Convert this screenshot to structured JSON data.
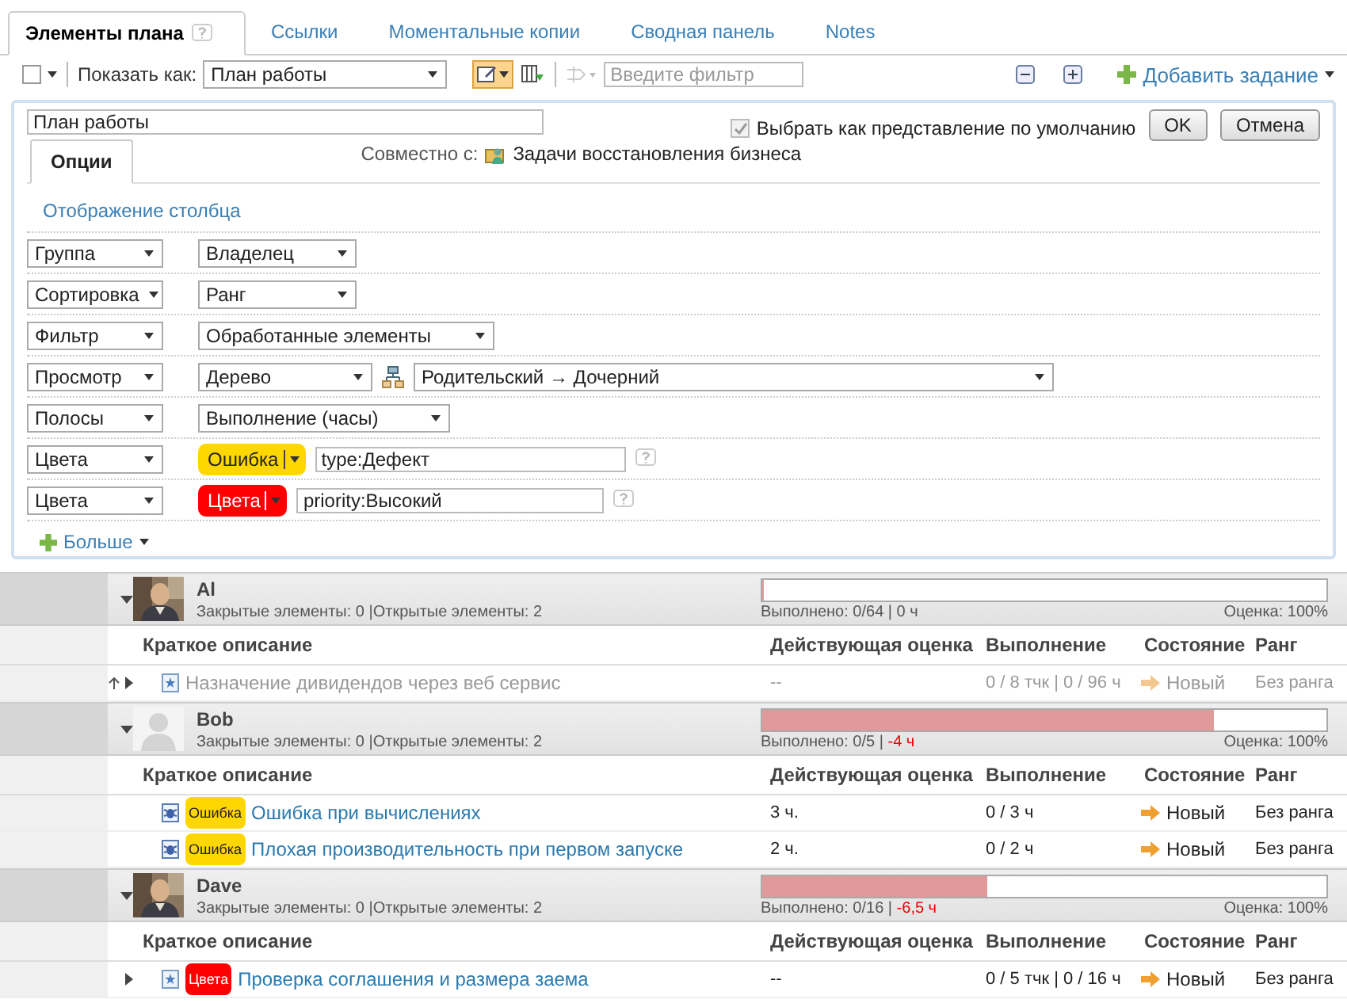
{
  "tabs": [
    {
      "label": "Элементы плана",
      "selected": true,
      "help": true
    },
    {
      "label": "Ссылки",
      "selected": false,
      "help": false
    },
    {
      "label": "Моментальные копии",
      "selected": false,
      "help": false
    },
    {
      "label": "Сводная панель",
      "selected": false,
      "help": false
    },
    {
      "label": "Notes",
      "selected": false,
      "help": false
    }
  ],
  "toolbar": {
    "select_all_checked": false,
    "show_as_label": "Показать как:",
    "view": "План работы",
    "view_editor_pressed": true,
    "filter_placeholder": "Введите фильтр",
    "add_task": "Добавить задание"
  },
  "editor": {
    "name": "План работы",
    "default_checkbox": {
      "label": "Выбрать как представление по умолчанию",
      "checked": true
    },
    "ok": "OK",
    "cancel": "Отмена",
    "options_tab": "Опции",
    "shared_label": "Совместно с:",
    "shared_value": "Задачи восстановления бизнеса",
    "column_link": "Отображение столбца",
    "rules": [
      {
        "kind": "select",
        "type": "Группа",
        "value": "Владелец"
      },
      {
        "kind": "select",
        "type": "Сортировка",
        "value": "Ранг"
      },
      {
        "kind": "select",
        "type": "Фильтр",
        "value": "Обработанные элементы"
      },
      {
        "kind": "hierarchy",
        "type": "Просмотр",
        "value": "Дерево",
        "detail": "Родительский → Дочерний"
      },
      {
        "kind": "select",
        "type": "Полосы",
        "value": "Выполнение (часы)"
      },
      {
        "kind": "color",
        "type": "Цвета",
        "tag": "Ошибка",
        "color": "#ffd700",
        "query": "type:Дефект"
      },
      {
        "kind": "color",
        "type": "Цвета",
        "tag": "Цвета",
        "color": "#ff0000",
        "query": "priority:Высокий"
      }
    ],
    "more": "Больше"
  },
  "groups": [
    {
      "name": "Al",
      "expanded": true,
      "has_photo": true,
      "stats": "Закрытые элементы: 0 |Открытые элементы: 2",
      "level": 0,
      "done": "Выполнено: 0/64 |",
      "hours": "0 ч",
      "overdue": false,
      "rating": "Оценка: 100%",
      "columns": [
        "Краткое описание",
        "Действующая оценка",
        "Выполнение",
        "Состояние",
        "Ранг"
      ],
      "rows": [
        {
          "kind": "task",
          "dimmed": true,
          "parent_link": true,
          "expandable": true,
          "title": "Назначение дивидендов через веб сервис",
          "estimate": "--",
          "progress": "0 / 8 тчк | 0 / 96 ч",
          "status": "Новый",
          "rank": "Без ранга"
        }
      ]
    },
    {
      "name": "Bob",
      "expanded": true,
      "has_photo": false,
      "stats": "Закрытые элементы: 0 |Открытые элементы: 2",
      "level": 0.8,
      "done": "Выполнено: 0/5 |",
      "hours": "-4 ч",
      "overdue": true,
      "rating": "Оценка: 100%",
      "columns": [
        "Краткое описание",
        "Действующая оценка",
        "Выполнение",
        "Состояние",
        "Ранг"
      ],
      "rows": [
        {
          "kind": "bug",
          "dimmed": false,
          "parent_link": false,
          "expandable": false,
          "tag": "Ошибка",
          "color": "#ffd700",
          "title": "Ошибка при вычислениях",
          "estimate": "3 ч.",
          "progress": "0 / 3 ч",
          "status": "Новый",
          "rank": "Без ранга"
        },
        {
          "kind": "bug",
          "dimmed": false,
          "parent_link": false,
          "expandable": false,
          "tag": "Ошибка",
          "color": "#ffd700",
          "title": "Плохая производительность при первом запуске",
          "estimate": "2 ч.",
          "progress": "0 / 2 ч",
          "status": "Новый",
          "rank": "Без ранга"
        }
      ]
    },
    {
      "name": "Dave",
      "expanded": true,
      "has_photo": true,
      "stats": "Закрытые элементы: 0 |Открытые элементы: 2",
      "level": 0.4,
      "done": "Выполнено: 0/16 |",
      "hours": "-6,5 ч",
      "overdue": true,
      "rating": "Оценка: 100%",
      "columns": [
        "Краткое описание",
        "Действующая оценка",
        "Выполнение",
        "Состояние",
        "Ранг"
      ],
      "rows": [
        {
          "kind": "task",
          "dimmed": false,
          "parent_link": false,
          "expandable": true,
          "tag": "Цвета",
          "color": "#ff0000",
          "title": "Проверка соглашения и размера заема",
          "estimate": "--",
          "progress": "0 / 5 тчк | 0 / 16 ч",
          "status": "Новый",
          "rank": "Без ранга"
        }
      ]
    }
  ]
}
